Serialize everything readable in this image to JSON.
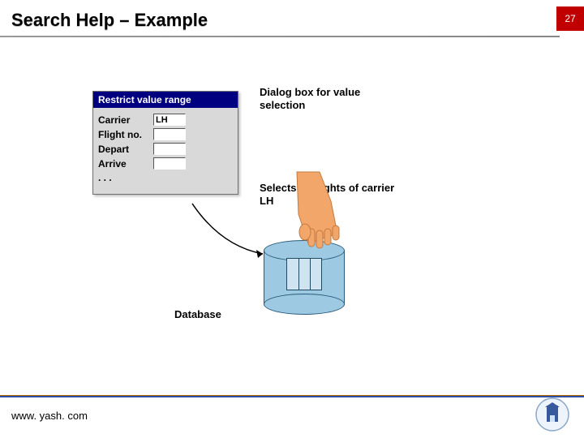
{
  "header": {
    "title": "Search Help – Example",
    "page_number": "27"
  },
  "dialog": {
    "title": "Restrict value range",
    "fields": {
      "carrier_label": "Carrier",
      "carrier_value": "LH",
      "flight_label": "Flight no.",
      "flight_value": "",
      "depart_label": "Depart",
      "depart_value": "",
      "arrive_label": "Arrive",
      "arrive_value": "",
      "more_label": ". . ."
    }
  },
  "annotations": {
    "dialog_box": "Dialog box for value selection",
    "selects": "Selects all flights of carrier LH",
    "database": "Database"
  },
  "footer": {
    "url": "www. yash. com"
  }
}
